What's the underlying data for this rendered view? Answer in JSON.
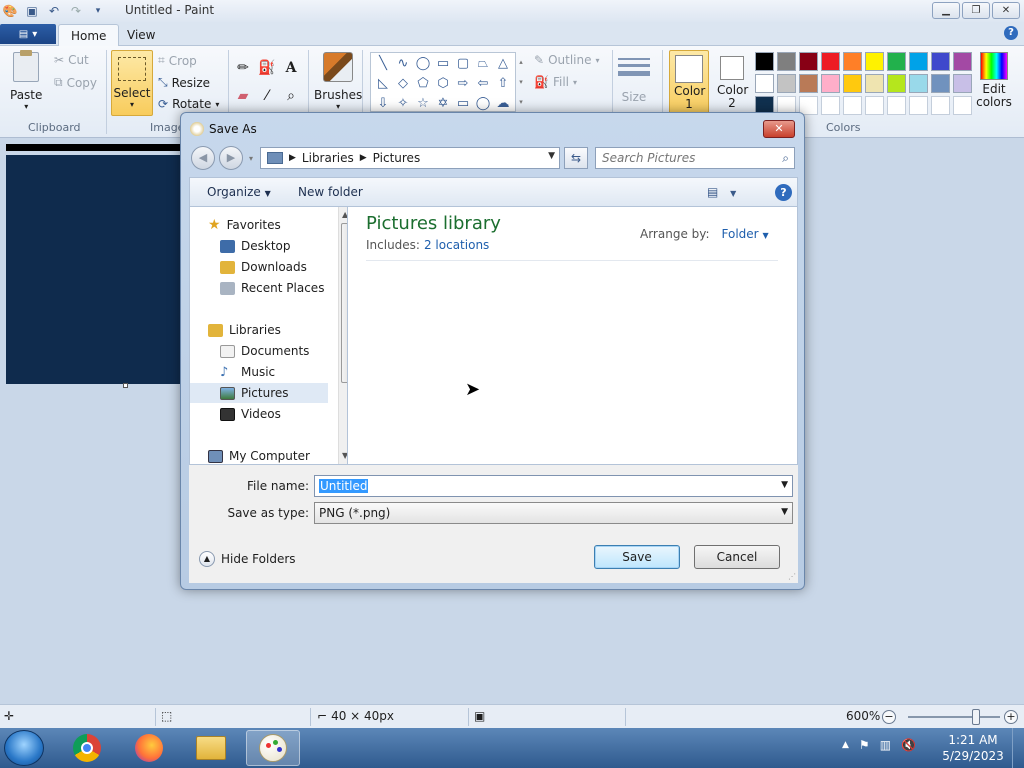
{
  "paint": {
    "title": "Untitled - Paint",
    "tabs": [
      "Home",
      "View"
    ],
    "clipboard": {
      "paste": "Paste",
      "cut": "Cut",
      "copy": "Copy",
      "label": "Clipboard"
    },
    "image": {
      "select": "Select",
      "crop": "Crop",
      "resize": "Resize",
      "rotate": "Rotate",
      "label": "Image"
    },
    "brushes": "Brushes",
    "shapes": {
      "outline": "Outline",
      "fill": "Fill"
    },
    "size": "Size",
    "color1": "Color 1",
    "color2": "Color 2",
    "colors_label": "Colors",
    "edit_colors": "Edit colors",
    "palette": [
      "#000000",
      "#7f7f7f",
      "#880015",
      "#ed1c24",
      "#ff7f27",
      "#fff200",
      "#22b14c",
      "#00a2e8",
      "#3f48cc",
      "#a349a4",
      "#ffffff",
      "#c3c3c3",
      "#b97a57",
      "#ffaec9",
      "#ffc90e",
      "#efe4b0",
      "#b5e61d",
      "#99d9ea",
      "#7092be",
      "#c8bfe7",
      "#10304f",
      "#ffffff",
      "#ffffff",
      "#ffffff",
      "#ffffff",
      "#ffffff",
      "#ffffff",
      "#ffffff",
      "#ffffff",
      "#ffffff"
    ],
    "status": {
      "dimensions": "40 × 40px",
      "zoom": "600%"
    }
  },
  "dialog": {
    "title": "Save As",
    "breadcrumb": [
      "Libraries",
      "Pictures"
    ],
    "search_placeholder": "Search Pictures",
    "organize": "Organize",
    "new_folder": "New folder",
    "nav": {
      "favorites": "Favorites",
      "favorites_items": [
        "Desktop",
        "Downloads",
        "Recent Places"
      ],
      "libraries": "Libraries",
      "libraries_items": [
        "Documents",
        "Music",
        "Pictures",
        "Videos"
      ],
      "computer": "My Computer"
    },
    "library_title": "Pictures library",
    "includes_label": "Includes:",
    "locations": "2 locations",
    "arrange_label": "Arrange by:",
    "arrange_value": "Folder",
    "file_name_label": "File name:",
    "file_name_value": "Untitled",
    "save_as_type_label": "Save as type:",
    "save_as_type_value": "PNG (*.png)",
    "hide_folders": "Hide Folders",
    "save_button": "Save",
    "cancel_button": "Cancel"
  },
  "taskbar": {
    "time": "1:21 AM",
    "date": "5/29/2023"
  }
}
